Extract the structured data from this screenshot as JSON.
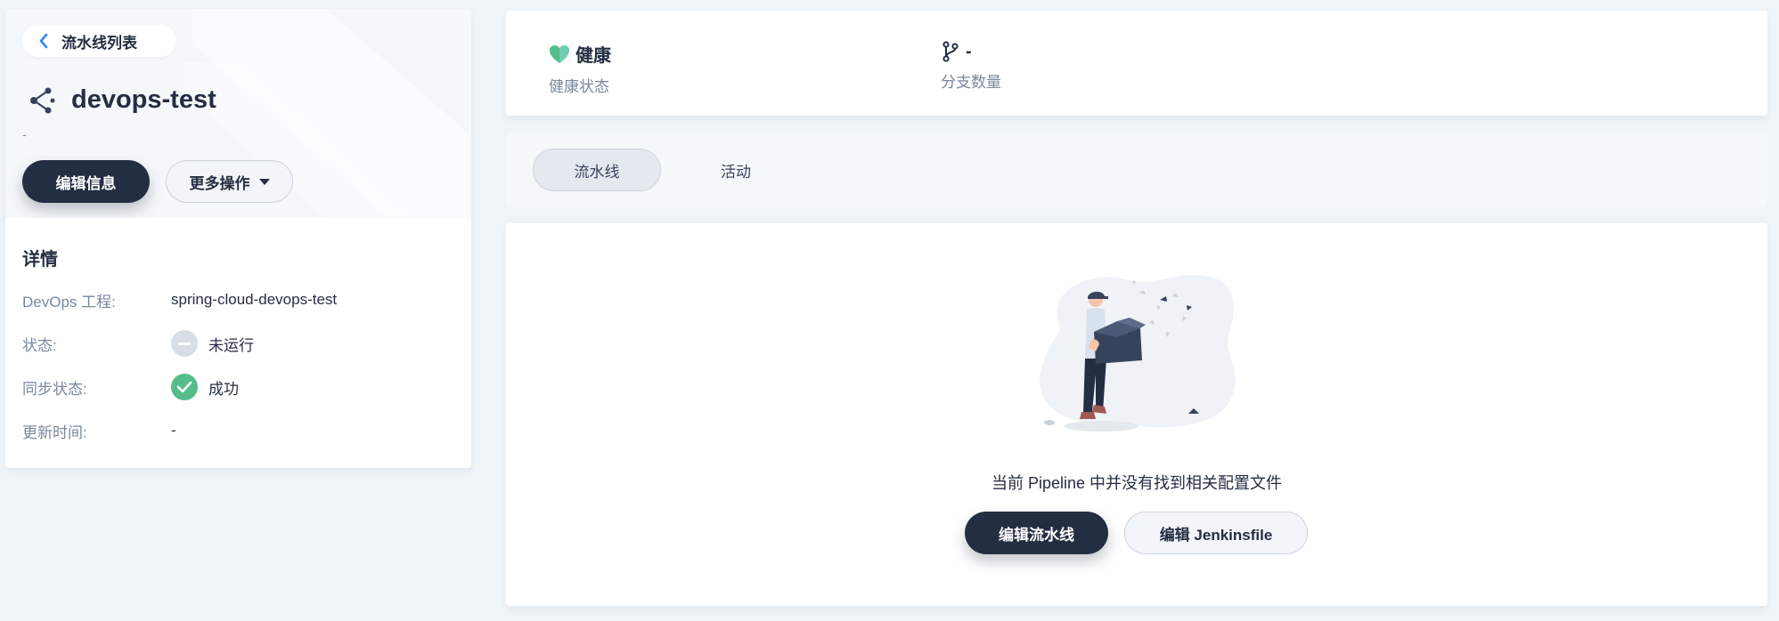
{
  "back": {
    "label": "流水线列表"
  },
  "pipeline": {
    "name": "devops-test",
    "description": "-"
  },
  "actions": {
    "edit_info": "编辑信息",
    "more_actions": "更多操作"
  },
  "details": {
    "title": "详情",
    "rows": [
      {
        "key": "DevOps 工程:",
        "value": "spring-cloud-devops-test"
      },
      {
        "key": "状态:",
        "value": "未运行"
      },
      {
        "key": "同步状态:",
        "value": "成功"
      },
      {
        "key": "更新时间:",
        "value": "-"
      }
    ]
  },
  "metrics": {
    "health": {
      "value": "健康",
      "label": "健康状态"
    },
    "branches": {
      "value": "-",
      "label": "分支数量"
    }
  },
  "tabs": [
    {
      "label": "流水线"
    },
    {
      "label": "活动"
    }
  ],
  "empty": {
    "message": "当前 Pipeline 中并没有找到相关配置文件",
    "edit_pipeline": "编辑流水线",
    "edit_jenkinsfile": "编辑 Jenkinsfile"
  },
  "colors": {
    "primary_dark": "#242e42",
    "success": "#55bc8a",
    "health": "#55bc8a",
    "page_bg": "#eff4f9"
  },
  "icons": {
    "back": "chevron-left-icon",
    "pipeline": "pipeline-icon",
    "health": "heart-icon",
    "branch": "git-branch-icon",
    "status_idle": "minus-circle-icon",
    "status_success": "check-circle-icon"
  }
}
